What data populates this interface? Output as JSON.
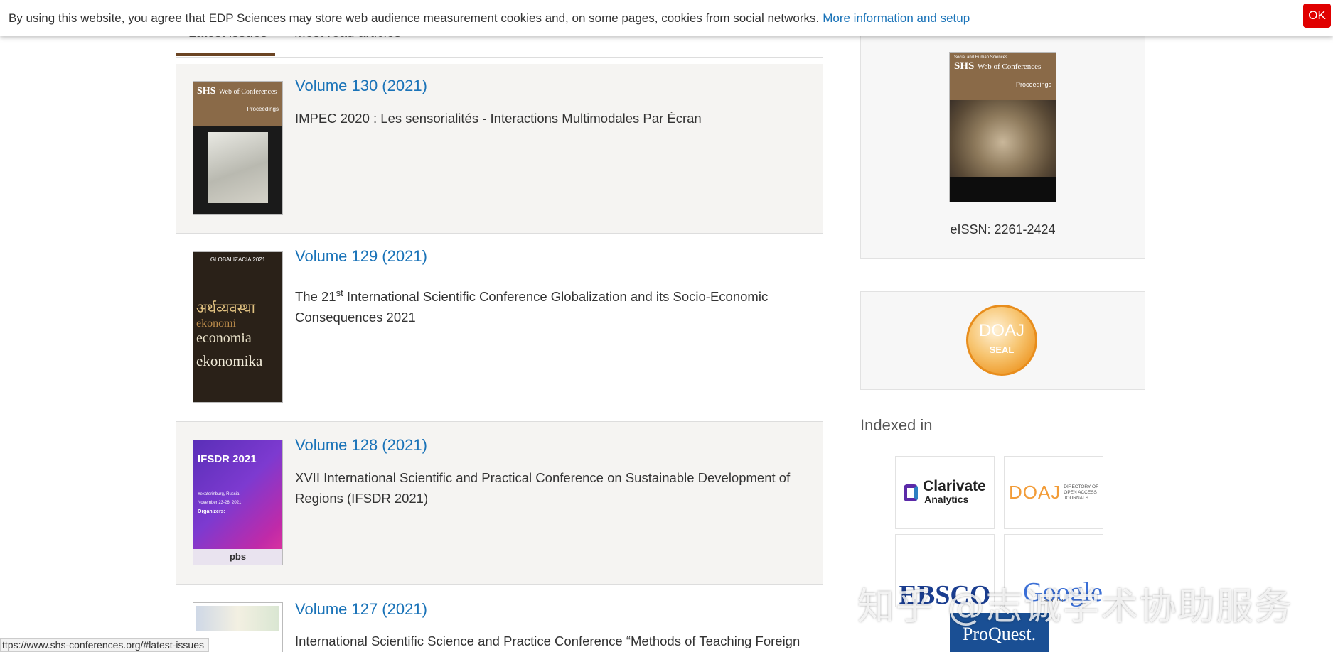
{
  "cookie_banner": {
    "text": "By using this website, you agree that EDP Sciences may store web audience measurement cookies and, on some pages, cookies from social networks.",
    "link": "More information and setup",
    "ok_label": "OK"
  },
  "tabs": [
    {
      "label": "Latest issues",
      "active": true
    },
    {
      "label": "Most read articles",
      "active": false
    }
  ],
  "issues": [
    {
      "title": "Volume 130 (2021)",
      "description": "IMPEC 2020 : Les sensorialités - Interactions Multimodales Par Écran"
    },
    {
      "title": "Volume 129 (2021)",
      "description_pre": "The 21",
      "description_sup": "st",
      "description_post": " International Scientific Conference Globalization and its Socio-Economic Consequences 2021"
    },
    {
      "title": "Volume 128 (2021)",
      "description": "XVII International Scientific and Practical Conference on Sustainable Development of Regions (IFSDR 2021)"
    },
    {
      "title": "Volume 127 (2021)",
      "description": "International Scientific Science and Practice Conference “Methods of Teaching Foreign"
    }
  ],
  "covers": {
    "v130": {
      "brand": "SHS",
      "subtitle": "Web of Conferences",
      "label": "Proceedings"
    },
    "v129": {
      "title": "GLOBALIZACIA 2021",
      "words": [
        "अर्थव्यवस्था",
        "ekonomi",
        "economia",
        "ekonomika"
      ]
    },
    "v128": {
      "title": "IFSDR 2021",
      "city": "Yekaterinburg, Russia",
      "dates": "November 23-26, 2021",
      "organizers": "Organizers:",
      "brand": "pbs"
    },
    "journal": {
      "small": "Social and Human Sciences",
      "brand": "SHS",
      "subtitle": "Web of Conferences",
      "label": "Proceedings"
    }
  },
  "sidebar": {
    "eissn": "eISSN: 2261-2424",
    "doaj_seal_top": "DOAJ",
    "doaj_seal_bottom": "SEAL",
    "indexed_title": "Indexed in",
    "logos": {
      "clarivate_1": "Clarivate",
      "clarivate_2": "Analytics",
      "doaj": "DOAJ",
      "doaj_sub_1": "DIRECTORY OF",
      "doaj_sub_2": "OPEN ACCESS",
      "doaj_sub_3": "JOURNALS",
      "ebsco": "EBSCO",
      "google": "Google",
      "google_sub": "scholar",
      "proquest": "ProQuest."
    }
  },
  "status_url": "ttps://www.shs-conferences.org/#latest-issues",
  "watermark": "知乎 @志诚学术协助服务",
  "colors": {
    "link": "#1a73b8",
    "tab_underline": "#6b4423",
    "ok_button": "#e00000",
    "row_grey": "#f5f4f2"
  }
}
